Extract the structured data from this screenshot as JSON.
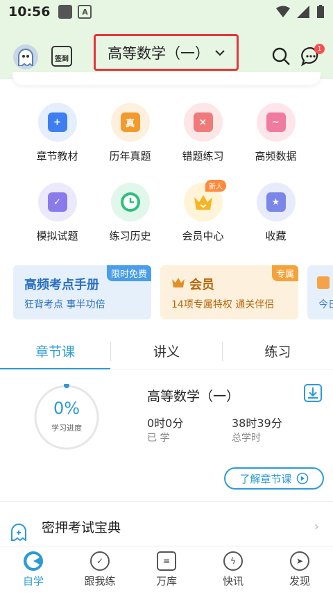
{
  "status": {
    "time": "10:56",
    "app_badge": "A"
  },
  "header": {
    "calendar_label": "签到",
    "subject": "高等数学（一）",
    "msg_count": "1"
  },
  "grid": [
    {
      "label": "章节教材",
      "icon": "book-shield-icon",
      "bg": "#e4eefc",
      "fg": "#3d7ff0"
    },
    {
      "label": "历年真题",
      "icon": "folder-icon",
      "bg": "#fdf0de",
      "fg": "#f39a2c",
      "glyph": "真"
    },
    {
      "label": "错题练习",
      "icon": "error-card-icon",
      "bg": "#fce6e6",
      "fg": "#ef7a7a"
    },
    {
      "label": "高频数据",
      "icon": "chart-card-icon",
      "bg": "#fce6ec",
      "fg": "#f07aa0"
    },
    {
      "label": "模拟试题",
      "icon": "mock-exam-icon",
      "bg": "#ece9fb",
      "fg": "#8a7bea"
    },
    {
      "label": "练习历史",
      "icon": "clock-icon",
      "bg": "#e1f7ec",
      "fg": "#2fbf7e"
    },
    {
      "label": "会员中心",
      "icon": "crown-icon",
      "bg": "#fff3d8",
      "fg": "#f5b524",
      "tag": "新人"
    },
    {
      "label": "收藏",
      "icon": "star-icon",
      "bg": "#e8ebfb",
      "fg": "#7a86e8"
    }
  ],
  "banners": [
    {
      "title": "高频考点手册",
      "sub": "狂背考点 事半功倍",
      "tag": "限时免费",
      "tag_color": "#4a9de8"
    },
    {
      "title": "会员",
      "sub": "14项专属特权 通关伴侣",
      "tag": "专属",
      "tag_color": "#f6a23a"
    },
    {
      "sub": "今日"
    }
  ],
  "tabs": [
    {
      "label": "章节课"
    },
    {
      "label": "讲义"
    },
    {
      "label": "练习"
    }
  ],
  "course": {
    "title": "高等数学（一）",
    "progress_label": "学习进度",
    "progress_value": "0%",
    "progress_fraction": 0.0,
    "learned": {
      "value": "0时0分",
      "label": "已 学"
    },
    "total": {
      "value": "38时39分",
      "label": "总学时"
    },
    "learn_button": "了解章节课"
  },
  "treasure": {
    "label": "密押考试宝典"
  },
  "nav": [
    {
      "label": "自学",
      "icon": "self-study-icon",
      "active": true
    },
    {
      "label": "跟我练",
      "icon": "practice-icon"
    },
    {
      "label": "万库",
      "icon": "library-icon"
    },
    {
      "label": "快讯",
      "icon": "news-icon"
    },
    {
      "label": "发现",
      "icon": "discover-icon"
    }
  ]
}
